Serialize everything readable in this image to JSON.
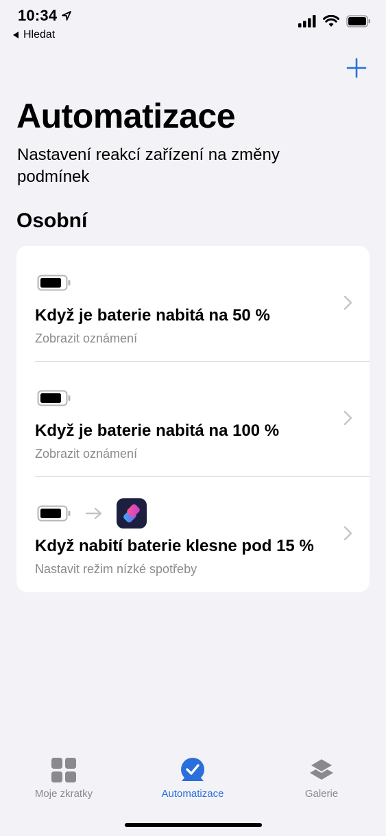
{
  "status_bar": {
    "time": "10:34",
    "back_app_label": "Hledat"
  },
  "header": {
    "add_icon": "plus-icon",
    "title": "Automatizace",
    "subtitle": "Nastavení reakcí zařízení na změny podmínek"
  },
  "section": {
    "title": "Osobní"
  },
  "automations": [
    {
      "title": "Když je baterie nabitá na 50 %",
      "subtitle": "Zobrazit oznámení",
      "icons": [
        "battery-icon"
      ]
    },
    {
      "title": "Když je baterie nabitá na 100 %",
      "subtitle": "Zobrazit oznámení",
      "icons": [
        "battery-icon"
      ]
    },
    {
      "title": "Když nabití baterie klesne pod 15 %",
      "subtitle": "Nastavit režim nízké spotřeby",
      "icons": [
        "battery-icon",
        "arrow-right-icon",
        "shortcuts-app-icon"
      ]
    }
  ],
  "tab_bar": {
    "tabs": [
      {
        "label": "Moje zkratky",
        "icon": "grid-icon",
        "active": false
      },
      {
        "label": "Automatizace",
        "icon": "clock-check-icon",
        "active": true
      },
      {
        "label": "Galerie",
        "icon": "layers-icon",
        "active": false
      }
    ]
  },
  "colors": {
    "accent": "#2a6fdb",
    "background": "#f2f2f7",
    "card": "#ffffff",
    "secondary_text": "#8a8a8e"
  }
}
